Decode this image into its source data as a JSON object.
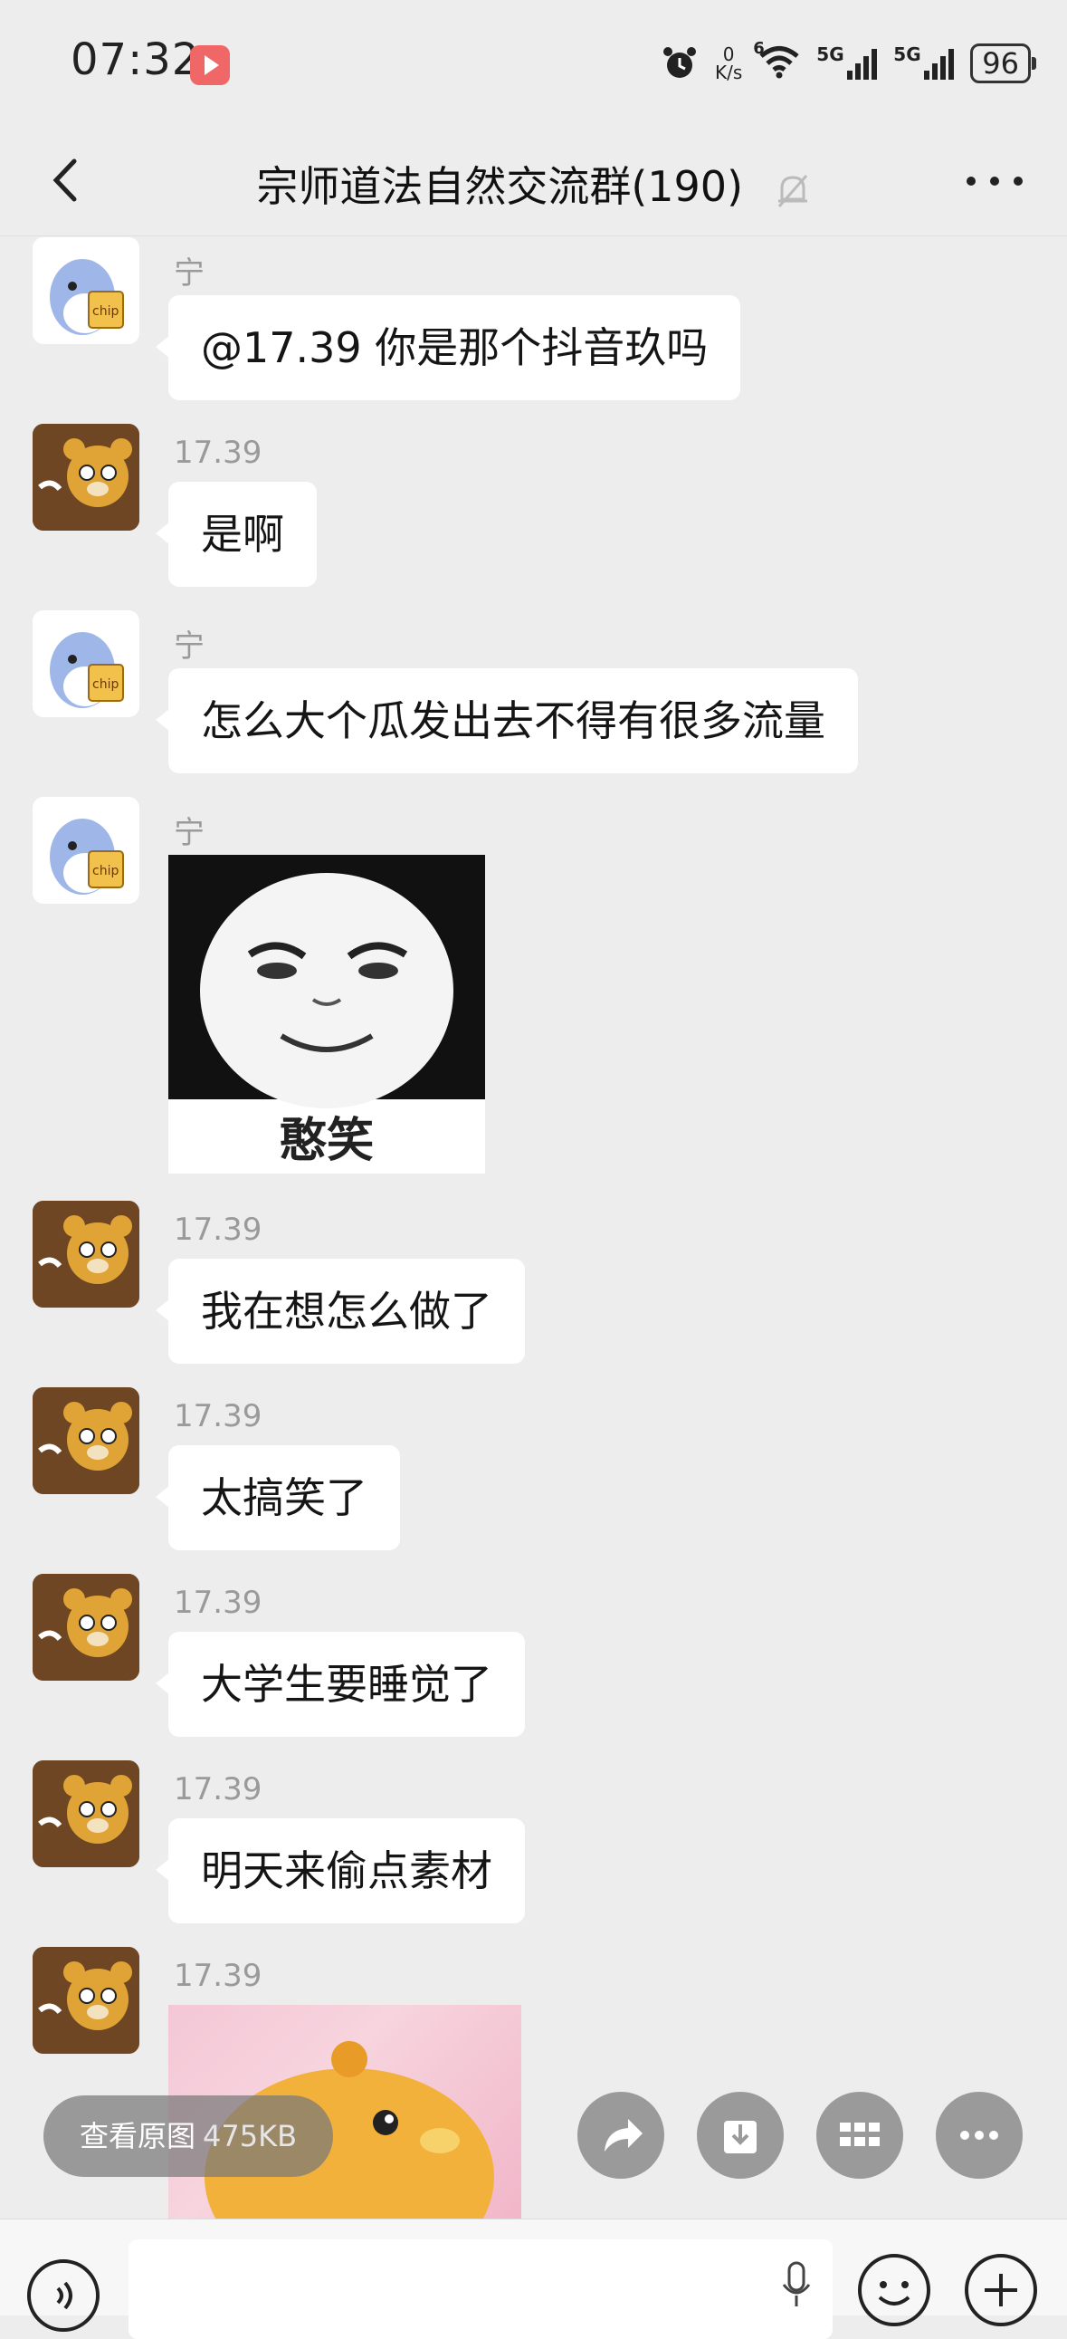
{
  "status_bar": {
    "time": "07:32",
    "net_speed_value": "0",
    "net_speed_unit": "K/s",
    "wifi_label": "6",
    "sim1_label": "5G",
    "sim2_label": "5G",
    "battery": "96"
  },
  "header": {
    "title": "宗师道法自然交流群(190)",
    "back_icon": "chevron-left-icon",
    "mute_icon": "bell-off-icon",
    "more_icon": "more-dots-icon"
  },
  "messages": [
    {
      "sender": "宁",
      "avatar": "shark-avatar",
      "text": "@17.39  你是那个抖音玖吗"
    },
    {
      "sender": "17.39",
      "avatar": "bear-avatar",
      "text": "是啊"
    },
    {
      "sender": "宁",
      "avatar": "shark-avatar",
      "text": "怎么大个瓜发出去不得有很多流量"
    },
    {
      "sender": "宁",
      "avatar": "shark-avatar",
      "sticker_caption": "憨笑"
    },
    {
      "sender": "17.39",
      "avatar": "bear-avatar",
      "text": "我在想怎么做了"
    },
    {
      "sender": "17.39",
      "avatar": "bear-avatar",
      "text": "太搞笑了"
    },
    {
      "sender": "17.39",
      "avatar": "bear-avatar",
      "text": "大学生要睡觉了"
    },
    {
      "sender": "17.39",
      "avatar": "bear-avatar",
      "text": "明天来偷点素材"
    },
    {
      "sender": "17.39",
      "avatar": "bear-avatar",
      "image": "pink-cartoon-image"
    }
  ],
  "image_actions": {
    "view_original_label": "查看原图",
    "view_original_size": "475KB",
    "icons": [
      "share-icon",
      "download-icon",
      "grid-icon",
      "more-icon"
    ]
  },
  "input_bar": {
    "voice_icon": "voice-icon",
    "mic_icon": "mic-icon",
    "emoji_icon": "emoji-icon",
    "plus_icon": "plus-icon"
  }
}
